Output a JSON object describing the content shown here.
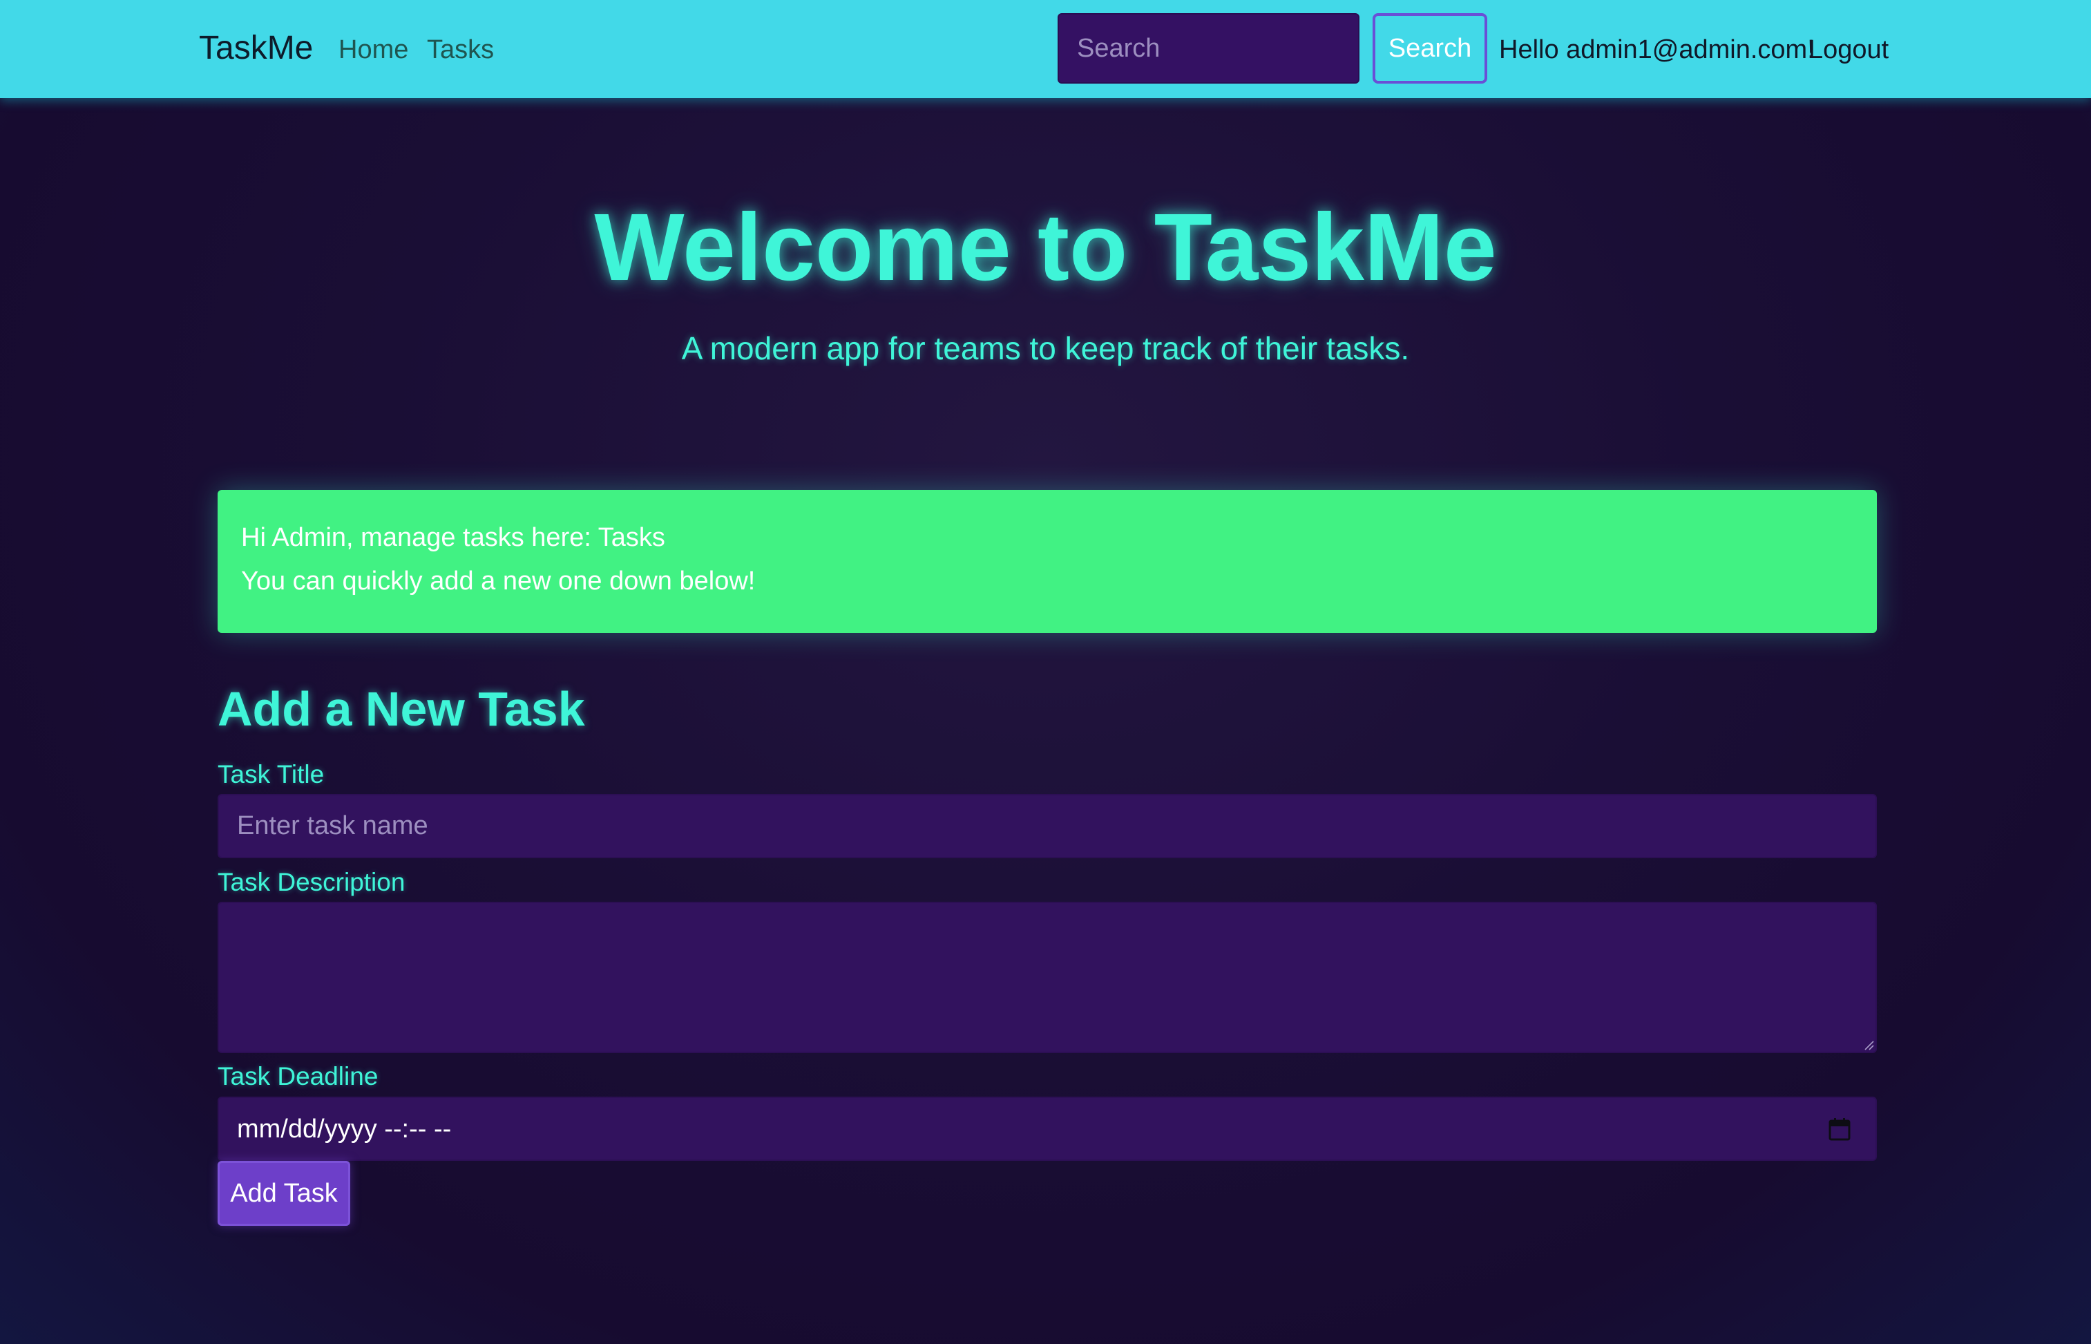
{
  "navbar": {
    "brand": "TaskMe",
    "links": [
      {
        "label": "Home"
      },
      {
        "label": "Tasks"
      }
    ],
    "search": {
      "placeholder": "Search",
      "value": "",
      "button_label": "Search"
    },
    "greeting": "Hello admin1@admin.com!",
    "logout_label": "Logout"
  },
  "hero": {
    "title": "Welcome to TaskMe",
    "subtitle": "A modern app for teams to keep track of their tasks."
  },
  "alert": {
    "line1_prefix": "Hi Admin, manage tasks here: ",
    "line1_link": "Tasks",
    "line2": "You can quickly add a new one down below!"
  },
  "form": {
    "heading": "Add a New Task",
    "title_label": "Task Title",
    "title_placeholder": "Enter task name",
    "title_value": "",
    "description_label": "Task Description",
    "description_value": "",
    "deadline_label": "Task Deadline",
    "deadline_value": "mm/dd/yyyy --:-- --",
    "submit_label": "Add Task"
  },
  "icons": {
    "calendar": "calendar-icon",
    "resize_grip": "resize-grip-icon"
  },
  "colors": {
    "navbar_bg": "#42d9e8",
    "page_bg": "#1a0e35",
    "accent_text": "#3ff5d8",
    "alert_bg": "#41f283",
    "input_bg": "#32125e",
    "button_bg": "#6d3fc9",
    "search_button_border": "#6a4fd6"
  }
}
